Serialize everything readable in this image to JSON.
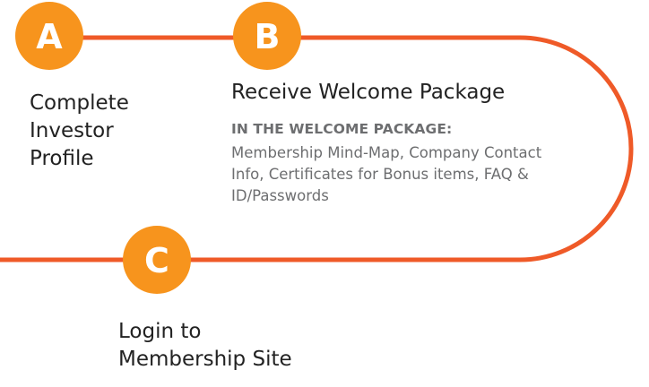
{
  "colors": {
    "path_line": "#ef5a28",
    "node_fill": "#f7941d",
    "node_letter": "#ffffff",
    "label_text": "#222222",
    "detail_text": "#6d6e70"
  },
  "steps": [
    {
      "letter": "A",
      "label": "Complete\nInvestor\nProfile"
    },
    {
      "letter": "B",
      "label": "Receive Welcome Package"
    },
    {
      "letter": "C",
      "label": "Login to\nMembership Site"
    }
  ],
  "welcome_package": {
    "heading": "IN THE WELCOME PACKAGE:",
    "contents": "Membership Mind-Map, Company Contact Info, Certificates for Bonus items, FAQ & ID/Passwords"
  }
}
